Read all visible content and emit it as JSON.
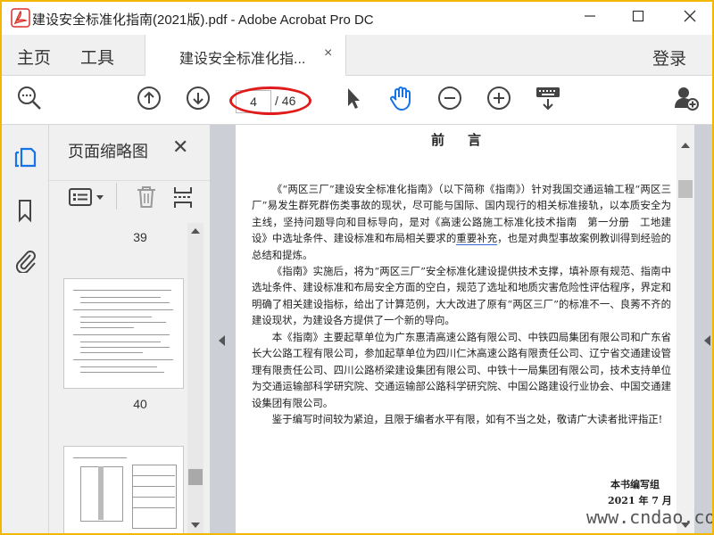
{
  "window": {
    "title": "建设安全标准化指南(2021版).pdf - Adobe Acrobat Pro DC",
    "minimize_icon": "minimize-icon",
    "maximize_icon": "maximize-icon",
    "close_icon": "close-icon"
  },
  "tabs": {
    "home": "主页",
    "tools": "工具",
    "document": "建设安全标准化指...",
    "document_close": "×",
    "login": "登录"
  },
  "toolbar": {
    "current_page": "4",
    "total_pages": "/ 46",
    "icons": [
      "zoom-search-icon",
      "page-up-icon",
      "page-down-icon",
      "select-arrow-icon",
      "hand-tool-icon",
      "zoom-out-icon",
      "zoom-in-icon",
      "keyboard-icon",
      "add-user-icon"
    ],
    "highlight_color": "#e01b1b",
    "accent_color": "#1473e6"
  },
  "rail": {
    "icons": [
      "page-thumbnails-icon",
      "bookmark-icon",
      "attachment-icon"
    ]
  },
  "thumbnail_panel": {
    "title": "页面缩略图",
    "close": "✕",
    "page_labels": [
      "39",
      "40"
    ]
  },
  "document": {
    "heading": "前言",
    "paragraphs": [
      {
        "before": "《“两区三厂”建设安全标准化指南》（以下简称《指南》）针对我国交通运输工程“两区三厂”易发生群死群伤类事故的现状，尽可能与国际、国内现行的相关标准接轨，以本质安全为主线，坚持问题导向和目标导向，是对《高速公路施工标准化技术指南　第一分册　工地建设》中选址条件、建设标准和布局相关要求的",
        "highlight": "重要补充",
        "after": "，也是对典型事故案例教训得到经验的总结和提炼。"
      },
      {
        "before": "《指南》实施后，将为“两区三厂”安全标准化建设提供技术支撑，填补原有规范、指南中选址条件、建设标准和布局安全方面的空白，规范了选址和地质灾害危险性评估程序，界定和明确了相关建设指标，给出了计算范例，大大改进了原有“两区三厂”的标准不一、良莠不齐的建设现状，为建设各方提供了一个新的导向。",
        "highlight": "",
        "after": ""
      },
      {
        "before": "本《指南》主要起草单位为广东惠清高速公路有限公司、中铁四局集团有限公司和广东省长大公路工程有限公司，参加起草单位为四川仁沐高速公路有限责任公司、辽宁省交通建设管理有限责任公司、四川公路桥梁建设集团有限公司、中铁十一局集团有限公司，技术支持单位为交通运输部科学研究院、交通运输部公路科学研究院、中国公路建设行业协会、中国交通建设集团有限公司。",
        "highlight": "",
        "after": ""
      },
      {
        "before": "鉴于编写时间较为紧迫，且限于编者水平有限，如有不当之处，敬请广大读者批评指正!",
        "highlight": "",
        "after": ""
      }
    ],
    "signature": "本书编写组",
    "date": "2021 年 7 月"
  },
  "watermark": "www.cndao.com"
}
